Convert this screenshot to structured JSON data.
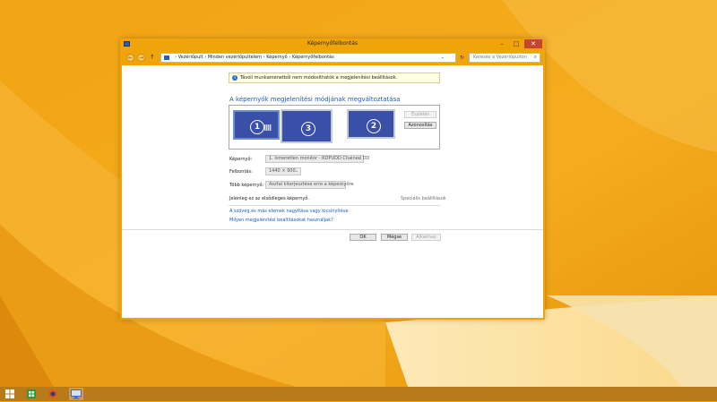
{
  "window": {
    "title": "Képernyőfelbontás",
    "controls": {
      "minimize": "–",
      "maximize": "□",
      "close": "✕"
    }
  },
  "address": {
    "back": "←",
    "forward": "→",
    "up": "↑",
    "crumbs": [
      "Vezérlőpult",
      "Minden vezérlőpultelem",
      "Képernyő",
      "Képernyőfelbontás"
    ],
    "separator": "›",
    "refresh": "↻",
    "search_placeholder": "Keresés a Vezérlőpulton",
    "search_icon": "⌕"
  },
  "info_bar": {
    "icon": "i",
    "text": "Távoli munkamenetből nem módosíthatók a megjelenítési beállítások."
  },
  "main": {
    "heading": "A képernyők megjelenítési módjának megváltoztatása",
    "monitors": [
      {
        "number": "1"
      },
      {
        "number": "3"
      },
      {
        "number": "2"
      }
    ],
    "detect_button": "Észlelés",
    "identify_button": "Azonosítás",
    "fields": {
      "display_label": "Képernyő:",
      "display_value": "1. Ismeretlen monitor - RDPUDD Chained DD",
      "resolution_label": "Felbontás:",
      "resolution_value": "1440 × 900",
      "multi_label": "Több képernyő:",
      "multi_value": "Asztal kiterjesztése erre a képernyőre"
    },
    "primary_text": "Jelenleg ez az elsődleges képernyő.",
    "advanced_link": "Speciális beállítások",
    "link1": "A szöveg és más elemek nagyítása vagy kicsinyítése",
    "link2": "Milyen megjelenítési beállításokat használjak?",
    "ok_button": "OK",
    "cancel_button": "Mégse",
    "apply_button": "Alkalmaz"
  },
  "colors": {
    "accent": "#f0a40a",
    "link": "#1f5db0",
    "monitor": "#3a50a8",
    "taskbar": "#b97a1a"
  },
  "taskbar_icons": [
    "start-icon",
    "store-icon",
    "firefox-icon",
    "remote-desktop-icon"
  ]
}
